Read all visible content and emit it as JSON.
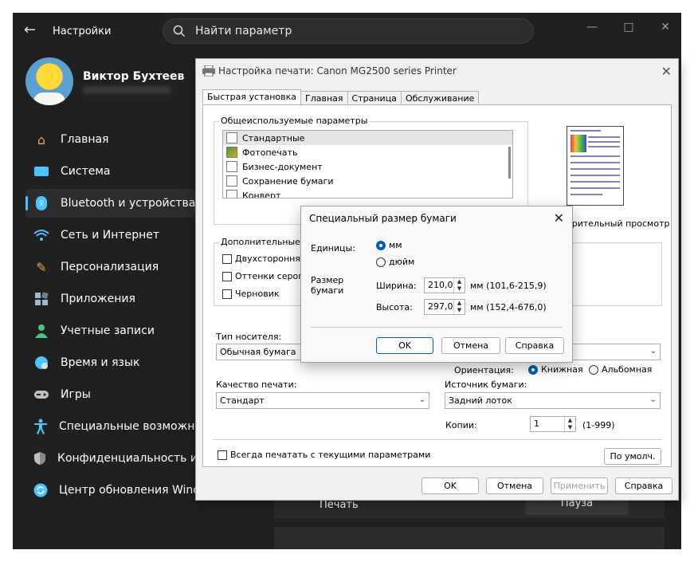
{
  "settings": {
    "app_title": "Настройки",
    "search_placeholder": "Найти параметр",
    "profile_name": "Виктор Бухтеев",
    "nav": [
      {
        "label": "Главная",
        "icon": "home-icon",
        "color": "#e8a060"
      },
      {
        "label": "Система",
        "icon": "monitor-icon",
        "color": "#4cc2ff"
      },
      {
        "label": "Bluetooth и устройства",
        "icon": "bluetooth-icon",
        "color": "#4cc2ff",
        "active": true
      },
      {
        "label": "Сеть и Интернет",
        "icon": "wifi-icon",
        "color": "#4cc2ff"
      },
      {
        "label": "Персонализация",
        "icon": "brush-icon",
        "color": "#f0a030"
      },
      {
        "label": "Приложения",
        "icon": "apps-icon",
        "color": "#a0b8d0"
      },
      {
        "label": "Учетные записи",
        "icon": "person-icon",
        "color": "#40c880"
      },
      {
        "label": "Время и язык",
        "icon": "globe-icon",
        "color": "#4cc2ff"
      },
      {
        "label": "Игры",
        "icon": "gamepad-icon",
        "color": "#c0c0c0"
      },
      {
        "label": "Специальные возможности",
        "icon": "accessibility-icon",
        "color": "#4cc2ff"
      },
      {
        "label": "Конфиденциальность и защита",
        "icon": "shield-icon",
        "color": "#c0c0c0"
      },
      {
        "label": "Центр обновления Windows",
        "icon": "update-icon",
        "color": "#4cc2ff"
      }
    ],
    "print_label": "Печать",
    "pause_label": "Пауза"
  },
  "print_dialog": {
    "title": "Настройка печати: Canon MG2500 series Printer",
    "tabs": [
      "Быстрая установка",
      "Главная",
      "Страница",
      "Обслуживание"
    ],
    "common_group": "Общеиспользуемые параметры",
    "presets": [
      "Стандартные",
      "Фотопечать",
      "Бизнес-документ",
      "Сохранение бумаги",
      "Конверт"
    ],
    "preview_label": "арительный просмотр",
    "extra_group": "Дополнительные фу",
    "checks": [
      "Двухсторонняя п",
      "Оттенки серого",
      "Черновик"
    ],
    "media_label": "Тип носителя:",
    "media_value": "Обычная бумага",
    "orientation_label": "Ориентация:",
    "orientation_portrait": "Книжная",
    "orientation_landscape": "Альбомная",
    "quality_label": "Качество печати:",
    "quality_value": "Стандарт",
    "source_label": "Источник бумаги:",
    "source_value": "Задний лоток",
    "copies_label": "Копии:",
    "copies_value": "1",
    "copies_range": "(1-999)",
    "always_print": "Всегда печатать с текущими параметрами",
    "defaults_btn": "По умолч.",
    "ok": "OK",
    "cancel": "Отмена",
    "apply": "Применить",
    "help": "Справка"
  },
  "size_dialog": {
    "title": "Специальный размер бумаги",
    "units_label": "Единицы:",
    "unit_mm": "мм",
    "unit_inch": "дюйм",
    "size_label": "Размер бумаги",
    "width_label": "Ширина:",
    "width_value": "210,0",
    "width_range": "мм (101,6-215,9)",
    "height_label": "Высота:",
    "height_value": "297,0",
    "height_range": "мм (152,4-676,0)",
    "ok": "OK",
    "cancel": "Отмена",
    "help": "Справка"
  }
}
